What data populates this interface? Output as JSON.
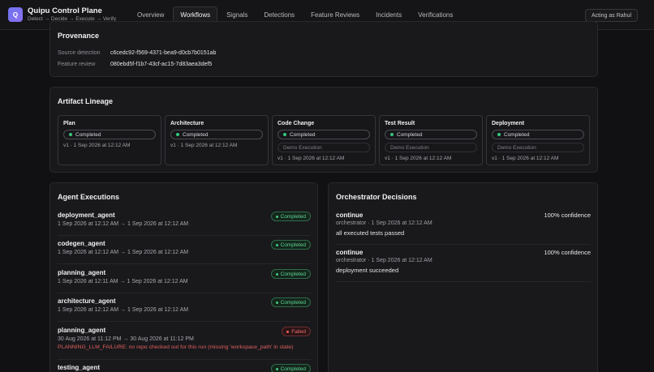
{
  "header": {
    "logo_letter": "Q",
    "title": "Quipu Control Plane",
    "subtitle": "Detect → Decide → Execute → Verify",
    "nav": [
      "Overview",
      "Workflows",
      "Signals",
      "Detections",
      "Feature Reviews",
      "Incidents",
      "Verifications"
    ],
    "active_nav": "Workflows",
    "acting_as": "Acting as Rahul"
  },
  "provenance": {
    "title": "Provenance",
    "source_detection_label": "Source detection",
    "source_detection_value": "c6cedc92-f569-4371-bea9-d0cb7b0151ab",
    "feature_review_label": "Feature review",
    "feature_review_value": "080ebd5f-f1b7-43cf-ac15-7d83aea3def5"
  },
  "lineage": {
    "title": "Artifact Lineage",
    "stages": [
      {
        "name": "Plan",
        "status": "Completed",
        "execution": "",
        "meta": "v1 · 1 Sep 2026 at 12:12 AM"
      },
      {
        "name": "Architecture",
        "status": "Completed",
        "execution": "",
        "meta": "v1 · 1 Sep 2026 at 12:12 AM"
      },
      {
        "name": "Code Change",
        "status": "Completed",
        "execution": "Demo Execution",
        "meta": "v1 · 1 Sep 2026 at 12:12 AM"
      },
      {
        "name": "Test Result",
        "status": "Completed",
        "execution": "Demo Execution",
        "meta": "v1 · 1 Sep 2026 at 12:12 AM"
      },
      {
        "name": "Deployment",
        "status": "Completed",
        "execution": "Demo Execution",
        "meta": "v1 · 1 Sep 2026 at 12:12 AM"
      }
    ]
  },
  "executions": {
    "title": "Agent Executions",
    "items": [
      {
        "agent": "deployment_agent",
        "time": "1 Sep 2026 at 12:12 AM → 1 Sep 2026 at 12:12 AM",
        "status": "Completed",
        "error": ""
      },
      {
        "agent": "codegen_agent",
        "time": "1 Sep 2026 at 12:12 AM → 1 Sep 2026 at 12:12 AM",
        "status": "Completed",
        "error": ""
      },
      {
        "agent": "planning_agent",
        "time": "1 Sep 2026 at 12:11 AM → 1 Sep 2026 at 12:12 AM",
        "status": "Completed",
        "error": ""
      },
      {
        "agent": "architecture_agent",
        "time": "1 Sep 2026 at 12:12 AM → 1 Sep 2026 at 12:12 AM",
        "status": "Completed",
        "error": ""
      },
      {
        "agent": "planning_agent",
        "time": "30 Aug 2026 at 11:12 PM → 30 Aug 2026 at 11:12 PM",
        "status": "Failed",
        "error": "PLANNING_LLM_FAILURE: no repo checked out for this run (missing 'workspace_path' in state)"
      },
      {
        "agent": "testing_agent",
        "time": "",
        "status": "Completed",
        "error": ""
      }
    ]
  },
  "decisions": {
    "title": "Orchestrator Decisions",
    "items": [
      {
        "action": "continue",
        "confidence": "100% confidence",
        "meta": "orchestrator · 1 Sep 2026 at 12:12 AM",
        "reason": "all executed tests passed"
      },
      {
        "action": "continue",
        "confidence": "100% confidence",
        "meta": "orchestrator · 1 Sep 2026 at 12:12 AM",
        "reason": "deployment succeeded"
      }
    ]
  }
}
